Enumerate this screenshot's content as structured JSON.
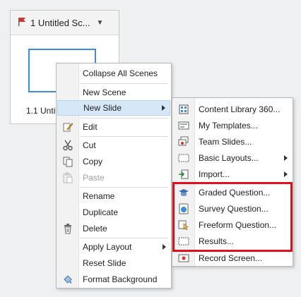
{
  "scene_panel": {
    "title": "1 Untitled Sc...",
    "slide_label": "1.1 Untitl"
  },
  "context_menu": {
    "items": [
      {
        "label": "Collapse All Scenes"
      },
      {
        "label": "New Scene"
      },
      {
        "label": "New Slide"
      },
      {
        "label": "Edit"
      },
      {
        "label": "Cut"
      },
      {
        "label": "Copy"
      },
      {
        "label": "Paste"
      },
      {
        "label": "Rename"
      },
      {
        "label": "Duplicate"
      },
      {
        "label": "Delete"
      },
      {
        "label": "Apply Layout"
      },
      {
        "label": "Reset Slide"
      },
      {
        "label": "Format Background"
      }
    ]
  },
  "submenu": {
    "items": [
      {
        "label": "Content Library 360..."
      },
      {
        "label": "My Templates..."
      },
      {
        "label": "Team Slides..."
      },
      {
        "label": "Basic Layouts..."
      },
      {
        "label": "Import..."
      },
      {
        "label": "Graded Question..."
      },
      {
        "label": "Survey Question..."
      },
      {
        "label": "Freeform Question..."
      },
      {
        "label": "Results..."
      },
      {
        "label": "Record Screen..."
      }
    ]
  },
  "colors": {
    "highlight": "#d6e8f8",
    "callout_border": "#e0101d",
    "selection_border": "#3c8dd6",
    "flag": "#d9302c"
  }
}
